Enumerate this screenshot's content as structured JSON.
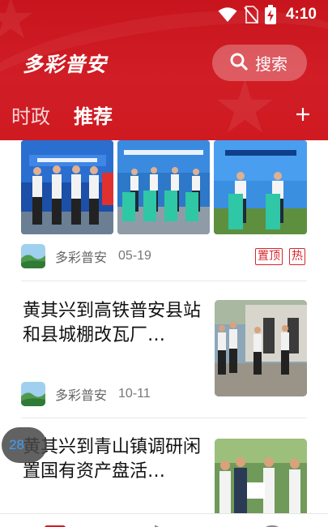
{
  "status_bar": {
    "time": "4:10",
    "icons": [
      "wifi-icon",
      "no-sim-icon",
      "battery-charging-icon"
    ]
  },
  "header": {
    "app_title": "多彩普安",
    "search_label": "搜索",
    "tabs": [
      {
        "label": "时政",
        "active": false
      },
      {
        "label": "推荐",
        "active": true
      }
    ],
    "add_channel_icon": "plus-icon",
    "background_color": "#cf1a22"
  },
  "feed": {
    "items": [
      {
        "type": "gallery",
        "source": "多彩普安",
        "date": "05-19",
        "tags": [
          "置顶",
          "热"
        ]
      },
      {
        "type": "article",
        "headline": "黄其兴到高铁普安县站和县城棚改瓦厂…",
        "source": "多彩普安",
        "date": "10-11"
      },
      {
        "type": "article",
        "headline": "黄其兴到青山镇调研闲置国有资产盘活…"
      }
    ]
  },
  "floating_counter": "28",
  "accent_color": "#d7262e"
}
